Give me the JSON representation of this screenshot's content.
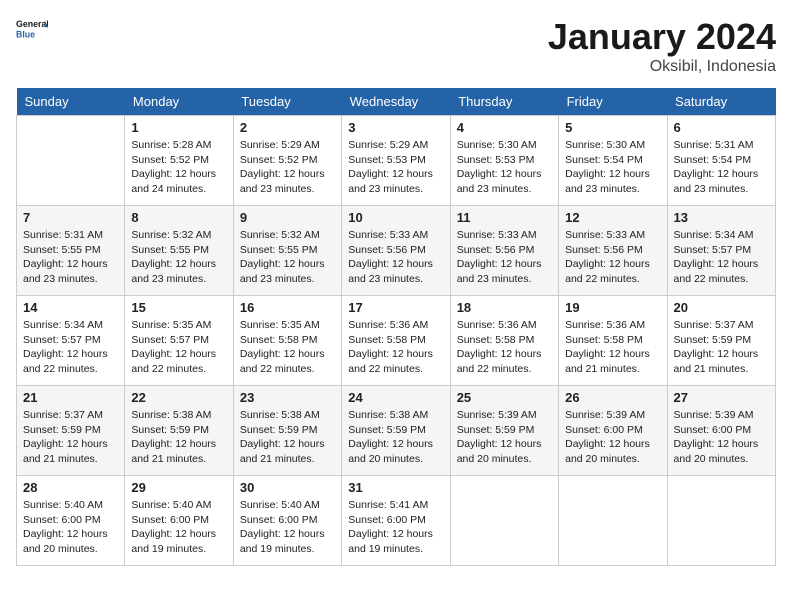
{
  "header": {
    "logo_line1": "General",
    "logo_line2": "Blue",
    "month": "January 2024",
    "location": "Oksibil, Indonesia"
  },
  "days_of_week": [
    "Sunday",
    "Monday",
    "Tuesday",
    "Wednesday",
    "Thursday",
    "Friday",
    "Saturday"
  ],
  "weeks": [
    [
      {
        "day": "",
        "sunrise": "",
        "sunset": "",
        "daylight": ""
      },
      {
        "day": "1",
        "sunrise": "Sunrise: 5:28 AM",
        "sunset": "Sunset: 5:52 PM",
        "daylight": "Daylight: 12 hours and 24 minutes."
      },
      {
        "day": "2",
        "sunrise": "Sunrise: 5:29 AM",
        "sunset": "Sunset: 5:52 PM",
        "daylight": "Daylight: 12 hours and 23 minutes."
      },
      {
        "day": "3",
        "sunrise": "Sunrise: 5:29 AM",
        "sunset": "Sunset: 5:53 PM",
        "daylight": "Daylight: 12 hours and 23 minutes."
      },
      {
        "day": "4",
        "sunrise": "Sunrise: 5:30 AM",
        "sunset": "Sunset: 5:53 PM",
        "daylight": "Daylight: 12 hours and 23 minutes."
      },
      {
        "day": "5",
        "sunrise": "Sunrise: 5:30 AM",
        "sunset": "Sunset: 5:54 PM",
        "daylight": "Daylight: 12 hours and 23 minutes."
      },
      {
        "day": "6",
        "sunrise": "Sunrise: 5:31 AM",
        "sunset": "Sunset: 5:54 PM",
        "daylight": "Daylight: 12 hours and 23 minutes."
      }
    ],
    [
      {
        "day": "7",
        "sunrise": "Sunrise: 5:31 AM",
        "sunset": "Sunset: 5:55 PM",
        "daylight": "Daylight: 12 hours and 23 minutes."
      },
      {
        "day": "8",
        "sunrise": "Sunrise: 5:32 AM",
        "sunset": "Sunset: 5:55 PM",
        "daylight": "Daylight: 12 hours and 23 minutes."
      },
      {
        "day": "9",
        "sunrise": "Sunrise: 5:32 AM",
        "sunset": "Sunset: 5:55 PM",
        "daylight": "Daylight: 12 hours and 23 minutes."
      },
      {
        "day": "10",
        "sunrise": "Sunrise: 5:33 AM",
        "sunset": "Sunset: 5:56 PM",
        "daylight": "Daylight: 12 hours and 23 minutes."
      },
      {
        "day": "11",
        "sunrise": "Sunrise: 5:33 AM",
        "sunset": "Sunset: 5:56 PM",
        "daylight": "Daylight: 12 hours and 23 minutes."
      },
      {
        "day": "12",
        "sunrise": "Sunrise: 5:33 AM",
        "sunset": "Sunset: 5:56 PM",
        "daylight": "Daylight: 12 hours and 22 minutes."
      },
      {
        "day": "13",
        "sunrise": "Sunrise: 5:34 AM",
        "sunset": "Sunset: 5:57 PM",
        "daylight": "Daylight: 12 hours and 22 minutes."
      }
    ],
    [
      {
        "day": "14",
        "sunrise": "Sunrise: 5:34 AM",
        "sunset": "Sunset: 5:57 PM",
        "daylight": "Daylight: 12 hours and 22 minutes."
      },
      {
        "day": "15",
        "sunrise": "Sunrise: 5:35 AM",
        "sunset": "Sunset: 5:57 PM",
        "daylight": "Daylight: 12 hours and 22 minutes."
      },
      {
        "day": "16",
        "sunrise": "Sunrise: 5:35 AM",
        "sunset": "Sunset: 5:58 PM",
        "daylight": "Daylight: 12 hours and 22 minutes."
      },
      {
        "day": "17",
        "sunrise": "Sunrise: 5:36 AM",
        "sunset": "Sunset: 5:58 PM",
        "daylight": "Daylight: 12 hours and 22 minutes."
      },
      {
        "day": "18",
        "sunrise": "Sunrise: 5:36 AM",
        "sunset": "Sunset: 5:58 PM",
        "daylight": "Daylight: 12 hours and 22 minutes."
      },
      {
        "day": "19",
        "sunrise": "Sunrise: 5:36 AM",
        "sunset": "Sunset: 5:58 PM",
        "daylight": "Daylight: 12 hours and 21 minutes."
      },
      {
        "day": "20",
        "sunrise": "Sunrise: 5:37 AM",
        "sunset": "Sunset: 5:59 PM",
        "daylight": "Daylight: 12 hours and 21 minutes."
      }
    ],
    [
      {
        "day": "21",
        "sunrise": "Sunrise: 5:37 AM",
        "sunset": "Sunset: 5:59 PM",
        "daylight": "Daylight: 12 hours and 21 minutes."
      },
      {
        "day": "22",
        "sunrise": "Sunrise: 5:38 AM",
        "sunset": "Sunset: 5:59 PM",
        "daylight": "Daylight: 12 hours and 21 minutes."
      },
      {
        "day": "23",
        "sunrise": "Sunrise: 5:38 AM",
        "sunset": "Sunset: 5:59 PM",
        "daylight": "Daylight: 12 hours and 21 minutes."
      },
      {
        "day": "24",
        "sunrise": "Sunrise: 5:38 AM",
        "sunset": "Sunset: 5:59 PM",
        "daylight": "Daylight: 12 hours and 20 minutes."
      },
      {
        "day": "25",
        "sunrise": "Sunrise: 5:39 AM",
        "sunset": "Sunset: 5:59 PM",
        "daylight": "Daylight: 12 hours and 20 minutes."
      },
      {
        "day": "26",
        "sunrise": "Sunrise: 5:39 AM",
        "sunset": "Sunset: 6:00 PM",
        "daylight": "Daylight: 12 hours and 20 minutes."
      },
      {
        "day": "27",
        "sunrise": "Sunrise: 5:39 AM",
        "sunset": "Sunset: 6:00 PM",
        "daylight": "Daylight: 12 hours and 20 minutes."
      }
    ],
    [
      {
        "day": "28",
        "sunrise": "Sunrise: 5:40 AM",
        "sunset": "Sunset: 6:00 PM",
        "daylight": "Daylight: 12 hours and 20 minutes."
      },
      {
        "day": "29",
        "sunrise": "Sunrise: 5:40 AM",
        "sunset": "Sunset: 6:00 PM",
        "daylight": "Daylight: 12 hours and 19 minutes."
      },
      {
        "day": "30",
        "sunrise": "Sunrise: 5:40 AM",
        "sunset": "Sunset: 6:00 PM",
        "daylight": "Daylight: 12 hours and 19 minutes."
      },
      {
        "day": "31",
        "sunrise": "Sunrise: 5:41 AM",
        "sunset": "Sunset: 6:00 PM",
        "daylight": "Daylight: 12 hours and 19 minutes."
      },
      {
        "day": "",
        "sunrise": "",
        "sunset": "",
        "daylight": ""
      },
      {
        "day": "",
        "sunrise": "",
        "sunset": "",
        "daylight": ""
      },
      {
        "day": "",
        "sunrise": "",
        "sunset": "",
        "daylight": ""
      }
    ]
  ]
}
